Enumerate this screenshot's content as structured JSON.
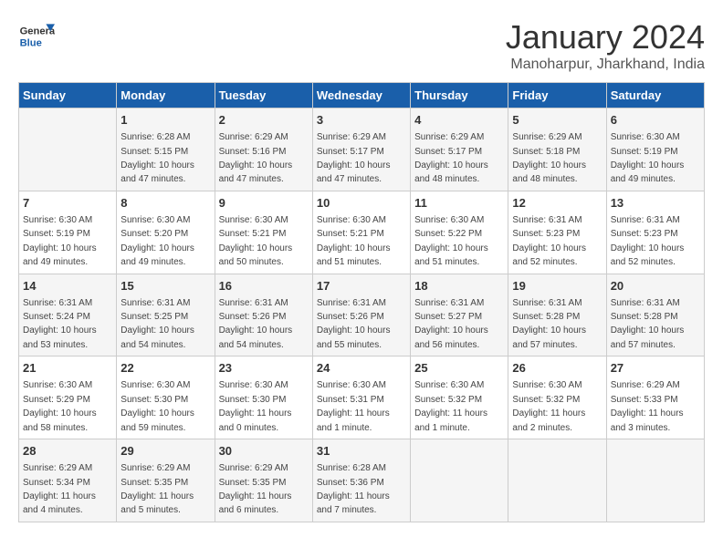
{
  "logo": {
    "line1": "General",
    "line2": "Blue"
  },
  "title": "January 2024",
  "subtitle": "Manoharpur, Jharkhand, India",
  "headers": [
    "Sunday",
    "Monday",
    "Tuesday",
    "Wednesday",
    "Thursday",
    "Friday",
    "Saturday"
  ],
  "weeks": [
    [
      {
        "day": "",
        "info": ""
      },
      {
        "day": "1",
        "info": "Sunrise: 6:28 AM\nSunset: 5:15 PM\nDaylight: 10 hours\nand 47 minutes."
      },
      {
        "day": "2",
        "info": "Sunrise: 6:29 AM\nSunset: 5:16 PM\nDaylight: 10 hours\nand 47 minutes."
      },
      {
        "day": "3",
        "info": "Sunrise: 6:29 AM\nSunset: 5:17 PM\nDaylight: 10 hours\nand 47 minutes."
      },
      {
        "day": "4",
        "info": "Sunrise: 6:29 AM\nSunset: 5:17 PM\nDaylight: 10 hours\nand 48 minutes."
      },
      {
        "day": "5",
        "info": "Sunrise: 6:29 AM\nSunset: 5:18 PM\nDaylight: 10 hours\nand 48 minutes."
      },
      {
        "day": "6",
        "info": "Sunrise: 6:30 AM\nSunset: 5:19 PM\nDaylight: 10 hours\nand 49 minutes."
      }
    ],
    [
      {
        "day": "7",
        "info": "Sunrise: 6:30 AM\nSunset: 5:19 PM\nDaylight: 10 hours\nand 49 minutes."
      },
      {
        "day": "8",
        "info": "Sunrise: 6:30 AM\nSunset: 5:20 PM\nDaylight: 10 hours\nand 49 minutes."
      },
      {
        "day": "9",
        "info": "Sunrise: 6:30 AM\nSunset: 5:21 PM\nDaylight: 10 hours\nand 50 minutes."
      },
      {
        "day": "10",
        "info": "Sunrise: 6:30 AM\nSunset: 5:21 PM\nDaylight: 10 hours\nand 51 minutes."
      },
      {
        "day": "11",
        "info": "Sunrise: 6:30 AM\nSunset: 5:22 PM\nDaylight: 10 hours\nand 51 minutes."
      },
      {
        "day": "12",
        "info": "Sunrise: 6:31 AM\nSunset: 5:23 PM\nDaylight: 10 hours\nand 52 minutes."
      },
      {
        "day": "13",
        "info": "Sunrise: 6:31 AM\nSunset: 5:23 PM\nDaylight: 10 hours\nand 52 minutes."
      }
    ],
    [
      {
        "day": "14",
        "info": "Sunrise: 6:31 AM\nSunset: 5:24 PM\nDaylight: 10 hours\nand 53 minutes."
      },
      {
        "day": "15",
        "info": "Sunrise: 6:31 AM\nSunset: 5:25 PM\nDaylight: 10 hours\nand 54 minutes."
      },
      {
        "day": "16",
        "info": "Sunrise: 6:31 AM\nSunset: 5:26 PM\nDaylight: 10 hours\nand 54 minutes."
      },
      {
        "day": "17",
        "info": "Sunrise: 6:31 AM\nSunset: 5:26 PM\nDaylight: 10 hours\nand 55 minutes."
      },
      {
        "day": "18",
        "info": "Sunrise: 6:31 AM\nSunset: 5:27 PM\nDaylight: 10 hours\nand 56 minutes."
      },
      {
        "day": "19",
        "info": "Sunrise: 6:31 AM\nSunset: 5:28 PM\nDaylight: 10 hours\nand 57 minutes."
      },
      {
        "day": "20",
        "info": "Sunrise: 6:31 AM\nSunset: 5:28 PM\nDaylight: 10 hours\nand 57 minutes."
      }
    ],
    [
      {
        "day": "21",
        "info": "Sunrise: 6:30 AM\nSunset: 5:29 PM\nDaylight: 10 hours\nand 58 minutes."
      },
      {
        "day": "22",
        "info": "Sunrise: 6:30 AM\nSunset: 5:30 PM\nDaylight: 10 hours\nand 59 minutes."
      },
      {
        "day": "23",
        "info": "Sunrise: 6:30 AM\nSunset: 5:30 PM\nDaylight: 11 hours\nand 0 minutes."
      },
      {
        "day": "24",
        "info": "Sunrise: 6:30 AM\nSunset: 5:31 PM\nDaylight: 11 hours\nand 1 minute."
      },
      {
        "day": "25",
        "info": "Sunrise: 6:30 AM\nSunset: 5:32 PM\nDaylight: 11 hours\nand 1 minute."
      },
      {
        "day": "26",
        "info": "Sunrise: 6:30 AM\nSunset: 5:32 PM\nDaylight: 11 hours\nand 2 minutes."
      },
      {
        "day": "27",
        "info": "Sunrise: 6:29 AM\nSunset: 5:33 PM\nDaylight: 11 hours\nand 3 minutes."
      }
    ],
    [
      {
        "day": "28",
        "info": "Sunrise: 6:29 AM\nSunset: 5:34 PM\nDaylight: 11 hours\nand 4 minutes."
      },
      {
        "day": "29",
        "info": "Sunrise: 6:29 AM\nSunset: 5:35 PM\nDaylight: 11 hours\nand 5 minutes."
      },
      {
        "day": "30",
        "info": "Sunrise: 6:29 AM\nSunset: 5:35 PM\nDaylight: 11 hours\nand 6 minutes."
      },
      {
        "day": "31",
        "info": "Sunrise: 6:28 AM\nSunset: 5:36 PM\nDaylight: 11 hours\nand 7 minutes."
      },
      {
        "day": "",
        "info": ""
      },
      {
        "day": "",
        "info": ""
      },
      {
        "day": "",
        "info": ""
      }
    ]
  ]
}
